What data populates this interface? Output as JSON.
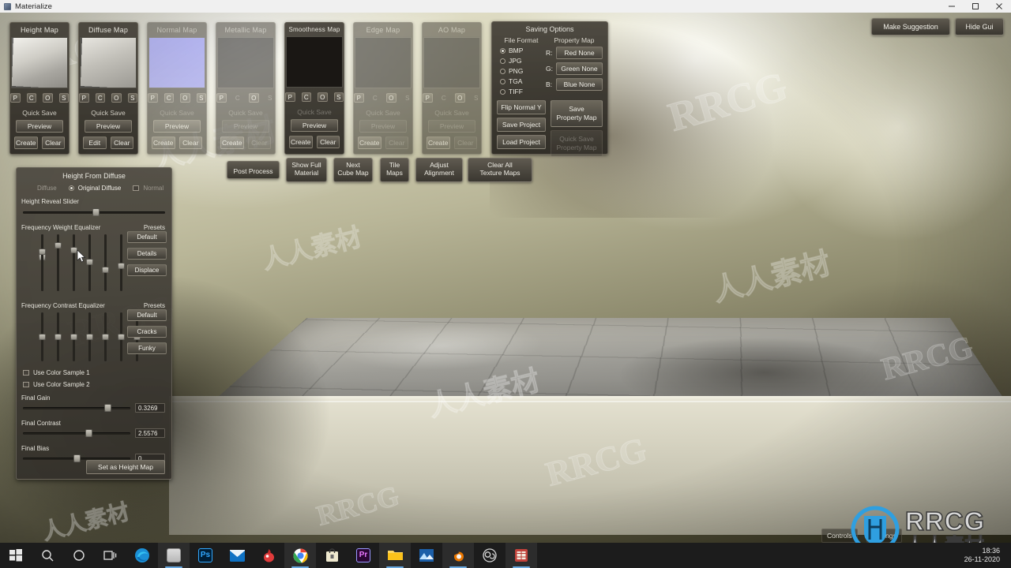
{
  "window": {
    "title": "Materialize",
    "icon": "app-icon",
    "minimize": "minimize-icon",
    "maximize": "maximize-icon",
    "close": "close-icon"
  },
  "top_right_buttons": [
    {
      "id": "make-suggestion",
      "label": "Make Suggestion"
    },
    {
      "id": "hide-gui",
      "label": "Hide Gui"
    }
  ],
  "map_panels": [
    {
      "id": "height-map",
      "title": "Height Map",
      "thumb": "stone-grayscale",
      "enabled": true,
      "has_image": true,
      "pcos": [
        {
          "label": "P",
          "on": true
        },
        {
          "label": "C",
          "on": true
        },
        {
          "label": "O",
          "on": true
        },
        {
          "label": "S",
          "on": true
        }
      ],
      "quick_save": "Quick Save",
      "quick_save_enabled": true,
      "preview": "Preview",
      "preview_enabled": true,
      "actions": [
        {
          "label": "Create",
          "enabled": true
        },
        {
          "label": "Clear",
          "enabled": true
        }
      ]
    },
    {
      "id": "diffuse-map",
      "title": "Diffuse Map",
      "thumb": "stone-color",
      "enabled": true,
      "has_image": true,
      "pcos": [
        {
          "label": "P",
          "on": true
        },
        {
          "label": "C",
          "on": true
        },
        {
          "label": "O",
          "on": true
        },
        {
          "label": "S",
          "on": true
        }
      ],
      "quick_save": "Quick Save",
      "quick_save_enabled": true,
      "preview": "Preview",
      "preview_enabled": true,
      "actions": [
        {
          "label": "Edit",
          "enabled": true
        },
        {
          "label": "Clear",
          "enabled": true
        }
      ]
    },
    {
      "id": "normal-map",
      "title": "Normal Map",
      "thumb": "normal-blue",
      "enabled": false,
      "has_image": true,
      "pcos": [
        {
          "label": "P",
          "on": true
        },
        {
          "label": "C",
          "on": true
        },
        {
          "label": "O",
          "on": true
        },
        {
          "label": "S",
          "on": true
        }
      ],
      "quick_save": "Quick Save",
      "quick_save_enabled": false,
      "preview": "Preview",
      "preview_enabled": true,
      "actions": [
        {
          "label": "Create",
          "enabled": true
        },
        {
          "label": "Clear",
          "enabled": true
        }
      ]
    },
    {
      "id": "metallic-map",
      "title": "Metallic Map",
      "thumb": "empty",
      "enabled": false,
      "has_image": false,
      "pcos": [
        {
          "label": "P",
          "on": true
        },
        {
          "label": "C",
          "on": false
        },
        {
          "label": "O",
          "on": true
        },
        {
          "label": "S",
          "on": false
        }
      ],
      "quick_save": "Quick Save",
      "quick_save_enabled": false,
      "preview": "Preview",
      "preview_enabled": false,
      "actions": [
        {
          "label": "Create",
          "enabled": true
        },
        {
          "label": "Clear",
          "enabled": false
        }
      ]
    },
    {
      "id": "smoothness-map",
      "title": "Smoothness Map",
      "thumb": "black",
      "enabled": true,
      "has_image": true,
      "pcos": [
        {
          "label": "P",
          "on": true
        },
        {
          "label": "C",
          "on": true
        },
        {
          "label": "O",
          "on": true
        },
        {
          "label": "S",
          "on": true
        }
      ],
      "quick_save": "Quick Save",
      "quick_save_enabled": false,
      "preview": "Preview",
      "preview_enabled": true,
      "actions": [
        {
          "label": "Create",
          "enabled": true
        },
        {
          "label": "Clear",
          "enabled": true
        }
      ]
    },
    {
      "id": "edge-map",
      "title": "Edge Map",
      "thumb": "empty",
      "enabled": false,
      "has_image": false,
      "pcos": [
        {
          "label": "P",
          "on": true
        },
        {
          "label": "C",
          "on": false
        },
        {
          "label": "O",
          "on": true
        },
        {
          "label": "S",
          "on": false
        }
      ],
      "quick_save": "Quick Save",
      "quick_save_enabled": false,
      "preview": "Preview",
      "preview_enabled": false,
      "actions": [
        {
          "label": "Create",
          "enabled": true
        },
        {
          "label": "Clear",
          "enabled": false
        }
      ]
    },
    {
      "id": "ao-map",
      "title": "AO Map",
      "thumb": "empty",
      "enabled": false,
      "has_image": false,
      "pcos": [
        {
          "label": "P",
          "on": true
        },
        {
          "label": "C",
          "on": false
        },
        {
          "label": "O",
          "on": true
        },
        {
          "label": "S",
          "on": false
        }
      ],
      "quick_save": "Quick Save",
      "quick_save_enabled": false,
      "preview": "Preview",
      "preview_enabled": false,
      "actions": [
        {
          "label": "Create",
          "enabled": true
        },
        {
          "label": "Clear",
          "enabled": false
        }
      ]
    }
  ],
  "saving_options": {
    "title": "Saving Options",
    "file_format_header": "File Format",
    "property_map_header": "Property Map",
    "formats": [
      {
        "label": "BMP",
        "selected": true
      },
      {
        "label": "JPG",
        "selected": false
      },
      {
        "label": "PNG",
        "selected": false
      },
      {
        "label": "TGA",
        "selected": false
      },
      {
        "label": "TIFF",
        "selected": false
      }
    ],
    "channels": [
      {
        "key": "R:",
        "value": "Red None"
      },
      {
        "key": "G:",
        "value": "Green None"
      },
      {
        "key": "B:",
        "value": "Blue None"
      }
    ],
    "flip_normal_y": "Flip Normal Y",
    "save_project": "Save Project",
    "load_project": "Load Project",
    "save_property_map": "Save\nProperty Map",
    "save_property_map_l1": "Save",
    "save_property_map_l2": "Property Map",
    "quick_save_property_map_l1": "Quick Save",
    "quick_save_property_map_l2": "Property Map",
    "quick_save_enabled": false
  },
  "toolbar": [
    {
      "id": "post-process",
      "l1": "Post Process",
      "l2": ""
    },
    {
      "id": "show-full-material",
      "l1": "Show Full",
      "l2": "Material"
    },
    {
      "id": "next-cube-map",
      "l1": "Next",
      "l2": "Cube Map"
    },
    {
      "id": "tile-maps",
      "l1": "Tile",
      "l2": "Maps"
    },
    {
      "id": "adjust-alignment",
      "l1": "Adjust",
      "l2": "Alignment"
    },
    {
      "id": "clear-all-texture-maps",
      "l1": "Clear All",
      "l2": "Texture Maps"
    }
  ],
  "height_from_diffuse": {
    "title": "Height From Diffuse",
    "source_modes": [
      {
        "label": "Diffuse",
        "selected": false,
        "type": "label"
      },
      {
        "label": "Original Diffuse",
        "selected": true,
        "type": "radio"
      },
      {
        "label": "Normal",
        "selected": false,
        "type": "checkbox"
      }
    ],
    "height_reveal_label": "Height Reveal Slider",
    "height_reveal_value": 52,
    "frequency_weight": {
      "label": "Frequency Weight Equalizer",
      "presets_label": "Presets",
      "presets": [
        "Default",
        "Details",
        "Displace"
      ],
      "values": [
        58,
        82,
        72,
        50,
        36,
        43,
        70
      ]
    },
    "frequency_contrast": {
      "label": "Frequency Contrast Equalizer",
      "presets_label": "Presets",
      "presets": [
        "Default",
        "Cracks",
        "Funky"
      ],
      "values": [
        50,
        50,
        50,
        50,
        50,
        50,
        50
      ]
    },
    "color_sample_1": {
      "label": "Use Color Sample 1",
      "checked": false
    },
    "color_sample_2": {
      "label": "Use Color Sample 2",
      "checked": false
    },
    "final_gain": {
      "label": "Final Gain",
      "value": "0.3269",
      "pos": 78
    },
    "final_contrast": {
      "label": "Final Contrast",
      "value": "2.5576",
      "pos": 60
    },
    "final_bias": {
      "label": "Final Bias",
      "value": "0",
      "pos": 49
    },
    "set_as_height_map": "Set as Height Map"
  },
  "hud": [
    {
      "id": "controls",
      "label": "Controls"
    },
    {
      "id": "settings",
      "label": "Settings"
    }
  ],
  "watermarks": {
    "brand": "RRCG",
    "chinese": "人人素材"
  },
  "taskbar": {
    "items": [
      {
        "id": "start",
        "icon": "windows-start-icon",
        "active": false
      },
      {
        "id": "search",
        "icon": "search-icon",
        "active": false
      },
      {
        "id": "cortana",
        "icon": "cortana-circle-icon",
        "active": false
      },
      {
        "id": "task-view",
        "icon": "task-view-icon",
        "active": false
      },
      {
        "id": "edge",
        "icon": "edge-browser-icon",
        "active": false
      },
      {
        "id": "file-manager",
        "icon": "file-manager-icon",
        "active": true
      },
      {
        "id": "photoshop",
        "icon": "photoshop-icon",
        "active": false
      },
      {
        "id": "mail",
        "icon": "mail-icon",
        "active": false
      },
      {
        "id": "app-red",
        "icon": "red-app-icon",
        "active": false
      },
      {
        "id": "chrome",
        "icon": "chrome-icon",
        "active": true
      },
      {
        "id": "store",
        "icon": "microsoft-store-icon",
        "active": false
      },
      {
        "id": "premiere",
        "icon": "premiere-pro-icon",
        "active": false
      },
      {
        "id": "explorer",
        "icon": "file-explorer-icon",
        "active": true
      },
      {
        "id": "photos",
        "icon": "photos-icon",
        "active": false
      },
      {
        "id": "blender",
        "icon": "blender-icon",
        "active": true
      },
      {
        "id": "obs",
        "icon": "obs-studio-icon",
        "active": false
      },
      {
        "id": "materialize",
        "icon": "materialize-icon",
        "active": true
      }
    ],
    "time": "18:36",
    "date": "26-11-2020"
  },
  "colors": {
    "accent": "#6aa9e0",
    "panel_bg": "#423e36",
    "button_bg": "#6a655a",
    "text": "#efede5",
    "taskbar_bg": "#1c1c1c",
    "logo_blue": "#2f9fe0"
  }
}
